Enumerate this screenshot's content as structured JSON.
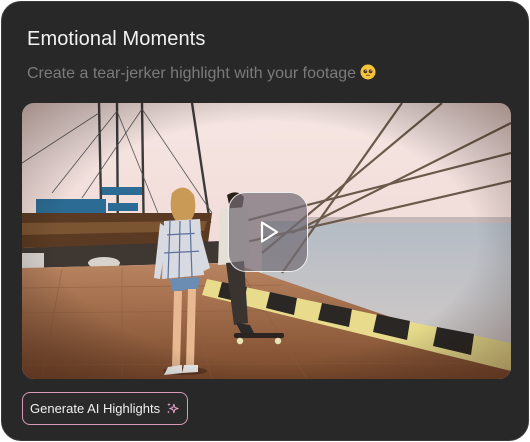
{
  "card": {
    "title": "Emotional Moments",
    "subtitle": "Create a tear-jerker highlight with your footage",
    "subtitle_emoji": "pleading-face-emoji"
  },
  "video": {
    "thumbnail": "two-people-walking-harbor-promenade-skateboard",
    "play_icon": "play-icon"
  },
  "actions": {
    "generate_label": "Generate AI Highlights",
    "generate_icon": "sparkles-icon"
  },
  "colors": {
    "card_bg": "#282828",
    "title": "#f2f2f2",
    "subtitle": "#7b7b7b",
    "button_border": "#d89ab8",
    "sparkle_accent": "#e7a4c6"
  }
}
